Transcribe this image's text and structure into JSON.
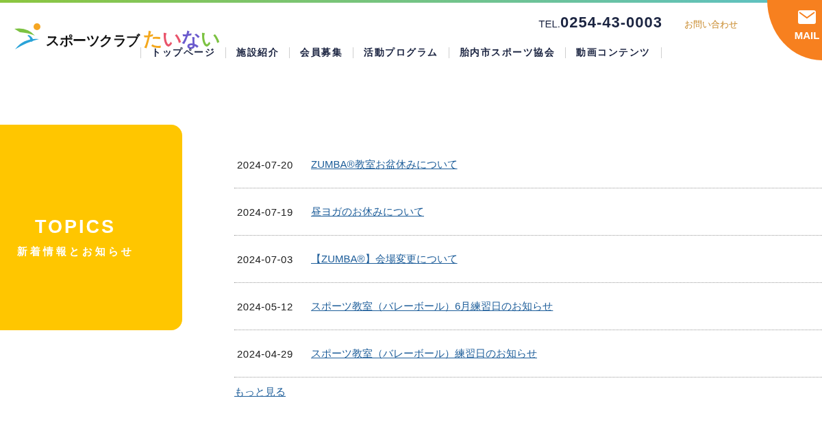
{
  "header": {
    "logo": {
      "name": "スポーツクラブ",
      "subname": [
        {
          "char": "た",
          "color": "#f4a81d"
        },
        {
          "char": "い",
          "color": "#e9546b"
        },
        {
          "char": "な",
          "color": "#6a5acd"
        },
        {
          "char": "い",
          "color": "#7cc242"
        }
      ]
    },
    "tel": {
      "label": "TEL.",
      "number": "0254-43-0003"
    },
    "contact_link": "お問い合わせ",
    "mail_button": "MAIL"
  },
  "nav": {
    "items": [
      "トップページ",
      "施設紹介",
      "会員募集",
      "活動プログラム",
      "胎内市スポーツ協会",
      "動画コンテンツ"
    ]
  },
  "topics": {
    "title": "TOPICS",
    "subtitle": "新着情報とお知らせ"
  },
  "news": [
    {
      "date": "2024-07-20",
      "title": "ZUMBA®教室お盆休みについて"
    },
    {
      "date": "2024-07-19",
      "title": "昼ヨガのお休みについて"
    },
    {
      "date": "2024-07-03",
      "title": "【ZUMBA®】会場変更について"
    },
    {
      "date": "2024-05-12",
      "title": "スポーツ教室（バレーボール）6月練習日のお知らせ"
    },
    {
      "date": "2024-04-29",
      "title": "スポーツ教室（バレーボール）練習日のお知らせ"
    }
  ],
  "more_link": "もっと見る"
}
